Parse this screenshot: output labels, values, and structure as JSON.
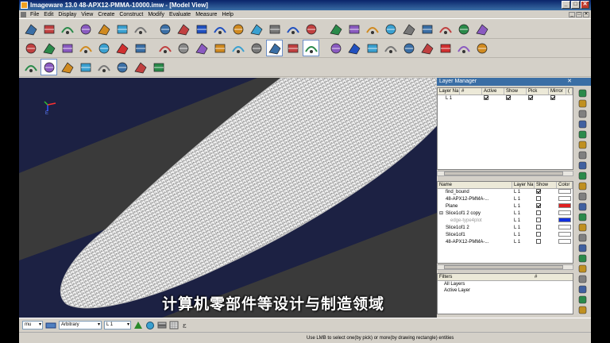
{
  "window": {
    "title": "Imageware 13.0    48-APX12-PMMA-10000.imw - [Model View]",
    "buttons": [
      "_",
      "□",
      "✕"
    ]
  },
  "menu": [
    "File",
    "Edit",
    "Display",
    "View",
    "Create",
    "Construct",
    "Modify",
    "Evaluate",
    "Measure",
    "Help"
  ],
  "toolbar_rows": [
    {
      "icons": [
        "curve-tool-icon",
        "dimension-icon",
        "measure-icon",
        "circle-arc-icon",
        "surface-icon",
        "mesh-icon",
        "pipe-icon",
        "loft-icon",
        "blend-icon",
        "surface-blue-icon",
        "surface-blue-icon",
        "sweep-icon",
        "extrude-icon",
        "fillet-icon",
        "surface-blue-icon",
        "offset-icon",
        "trim-icon",
        "split-icon",
        "revolve-icon",
        "cube-wire-icon",
        "cube-wire-icon",
        "node-icon",
        "sphere-icon",
        "axes-icon",
        "grid-icon"
      ]
    },
    {
      "icons": [
        "plane-icon",
        "cut-icon",
        "project-icon",
        "stack-icon",
        "layers-icon",
        "cloud-red-icon",
        "boolean-icon",
        "eye-icon",
        "surface-grey-icon",
        "sheet-icon",
        "sheet-icon",
        "slash-icon",
        "cone-icon",
        "cloud-sel-icon",
        "wave-icon",
        "wave-sel-icon",
        "arc-icon",
        "grid-blue-icon",
        "lightning-icon",
        "bend-icon",
        "point-icon",
        "spiral-icon",
        "delete-red-icon",
        "xmark-icon",
        "ring-icon"
      ]
    },
    {
      "icons": [
        "color-palette-icon",
        "globe-icon",
        "recycle-icon",
        "cloud-icon",
        "bug-icon",
        "points-icon",
        "dots-icon",
        "arc-yellow-icon"
      ]
    }
  ],
  "viewport": {
    "subtitle": "计算机零部件等设计与制造领域",
    "axis_label": "E"
  },
  "layer_manager": {
    "title": "Layer Manager",
    "close": "✕",
    "columns": [
      "Layer Na",
      "#",
      "Active",
      "Show",
      "Pick",
      "Mirror",
      "("
    ],
    "rows": [
      {
        "name": "L 1",
        "active": true,
        "show": true,
        "pick": true,
        "mirror": true
      }
    ],
    "object_columns": [
      "Name",
      "Layer Na",
      "Show",
      "Color"
    ],
    "objects": [
      {
        "name": "find_bound",
        "layer": "L 1",
        "show": true,
        "color": "#ffffff",
        "indent": 0
      },
      {
        "name": "48-APX12-PMMA-...",
        "layer": "L 1",
        "show": false,
        "color": "#ffffff",
        "indent": 0
      },
      {
        "name": "Plane",
        "layer": "L 1",
        "show": true,
        "color": "#e02020",
        "indent": 0
      },
      {
        "name": "Slice1of1 2 copy",
        "layer": "L 1",
        "show": false,
        "color": "#ffffff",
        "indent": 0,
        "expand": "⊟"
      },
      {
        "name": "edge-type4plot",
        "layer": "L 1",
        "show": false,
        "color": "#1030e0",
        "indent": 1,
        "grey": true
      },
      {
        "name": "Slice1of1 2",
        "layer": "L 1",
        "show": false,
        "color": "#ffffff",
        "indent": 0
      },
      {
        "name": "Slice1of1",
        "layer": "L 1",
        "show": false,
        "color": "#ffffff",
        "indent": 0
      },
      {
        "name": "48-APX12-PMMA-...",
        "layer": "L 1",
        "show": false,
        "color": "#ffffff",
        "indent": 0
      }
    ],
    "filters_title": "Filters",
    "filters_hash": "#",
    "filters": [
      "All Layers",
      "Active Layer"
    ]
  },
  "bottom": {
    "unit": "mu",
    "mode": "Arbitrary",
    "layer": "L 1"
  },
  "status": "Use LMB to select one(by pick) or more(by drawing rectangle) entities"
}
